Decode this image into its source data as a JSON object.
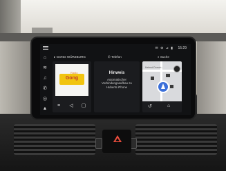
{
  "statusbar": {
    "clock": "15:29",
    "icons": "✉ ⊕ ⊿ ▮"
  },
  "radio_tab": {
    "label": "GONG WÜRZBURG",
    "logo_text": "Gong",
    "logo_sub": "Radio"
  },
  "phone_tab": {
    "label": "Telefon"
  },
  "notification": {
    "title": "Hinweis",
    "message": "Automatischer Verbindungsaufbau zu Huberts iPhone"
  },
  "nav_tab": {
    "label": "Suche",
    "street_label": "Helmut-Dorsch..."
  },
  "colors": {
    "screen_bg": "#111214",
    "tile_bg": "#1b1c1f",
    "nav_arrow": "#3b6fd9",
    "hazard": "#e74c3c",
    "radio_logo_yellow": "#f1c40f"
  },
  "icons": {
    "sidenav": [
      "home-icon",
      "radio-icon",
      "music-icon",
      "phone-icon",
      "car-icon",
      "navigation-icon"
    ],
    "radio_controls": [
      "list-icon",
      "mute-icon",
      "tile-toggle-icon"
    ],
    "nav_controls": [
      "history-icon",
      "home-destination-icon"
    ]
  }
}
